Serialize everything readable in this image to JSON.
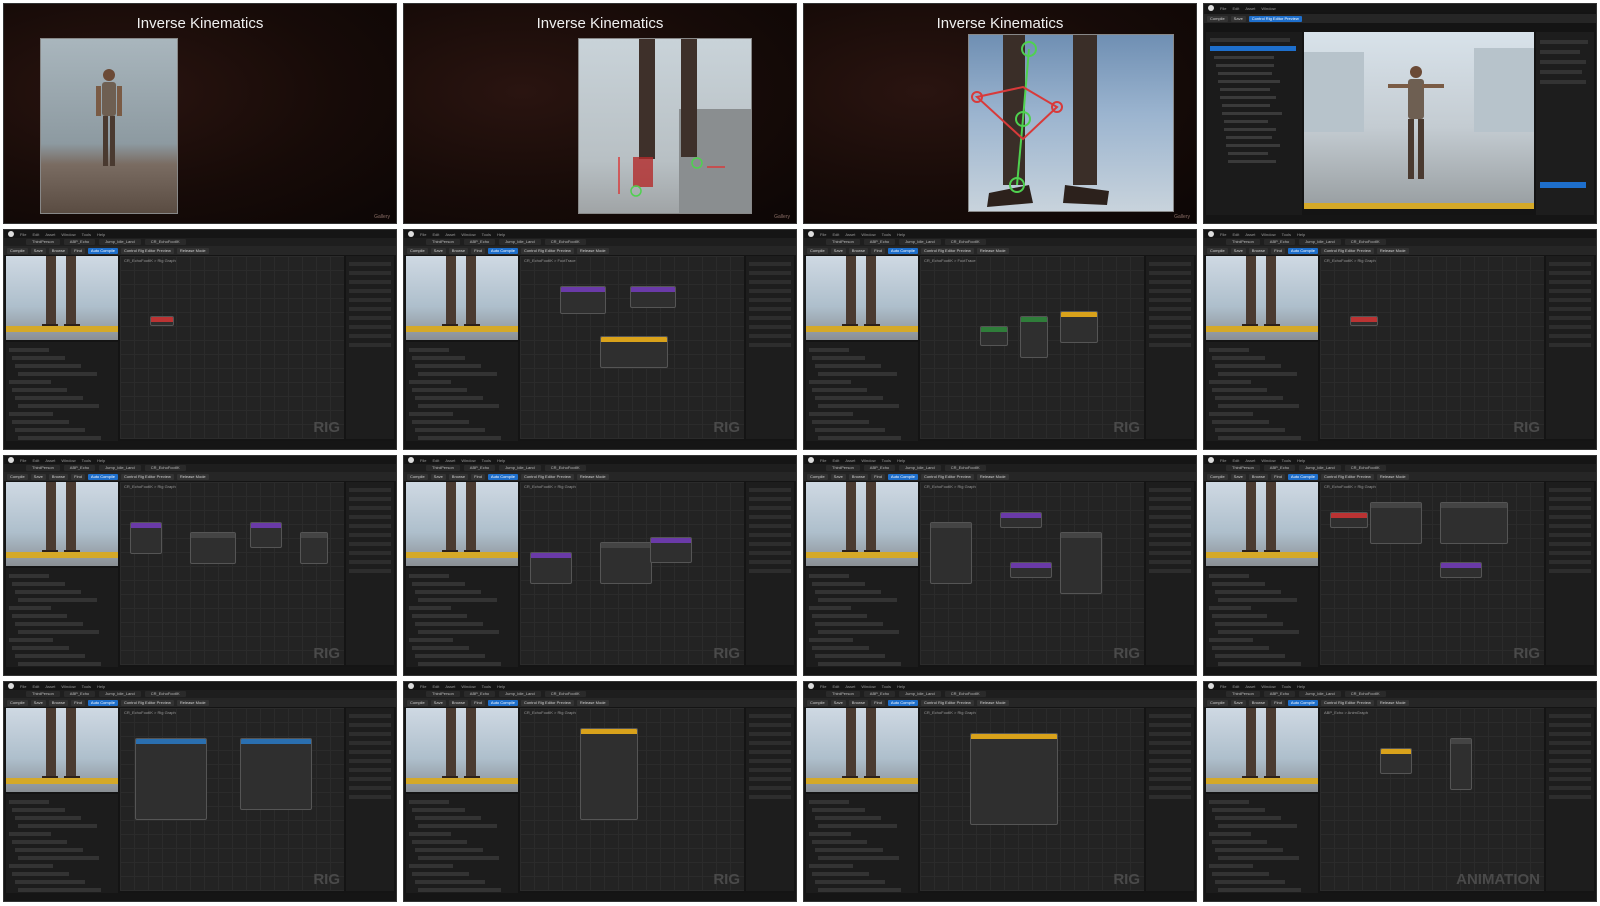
{
  "slides": [
    {
      "title": "Inverse Kinematics",
      "footer": "Gallery"
    },
    {
      "title": "Inverse Kinematics",
      "footer": "Gallery"
    },
    {
      "title": "Inverse Kinematics",
      "footer": "Gallery"
    }
  ],
  "editor": {
    "menu": [
      "File",
      "Edit",
      "Asset",
      "Window",
      "Tools",
      "Help"
    ],
    "tabs": [
      "ThirdPerson",
      "ABP_Echo",
      "Jump_Idle_Land",
      "CR_EchoFootIK"
    ],
    "toolbar": [
      "Compile",
      "Save",
      "Browse",
      "Find",
      "Auto Compile",
      "Control Rig Editor Preview",
      "Release Mode"
    ],
    "panels": [
      {
        "graph_title": "CR_EchoFootIK > Rig Graph",
        "watermark": "RIG"
      },
      {
        "graph_title": "CR_EchoFootIK > FootTrace",
        "watermark": "RIG"
      },
      {
        "graph_title": "CR_EchoFootIK > FootTrace",
        "watermark": "RIG"
      },
      {
        "graph_title": "CR_EchoFootIK > Rig Graph",
        "watermark": "RIG"
      },
      {
        "graph_title": "CR_EchoFootIK > Rig Graph",
        "watermark": "RIG"
      },
      {
        "graph_title": "CR_EchoFootIK > Rig Graph",
        "watermark": "RIG"
      },
      {
        "graph_title": "CR_EchoFootIK > Rig Graph",
        "watermark": "RIG"
      },
      {
        "graph_title": "CR_EchoFootIK > Rig Graph",
        "watermark": "RIG"
      },
      {
        "graph_title": "CR_EchoFootIK > Rig Graph",
        "watermark": "RIG"
      },
      {
        "graph_title": "CR_EchoFootIK > Rig Graph",
        "watermark": "RIG"
      },
      {
        "graph_title": "CR_EchoFootIK > Rig Graph",
        "watermark": "RIG"
      },
      {
        "graph_title": "ABP_Echo > AnimGraph",
        "watermark": "ANIMATION"
      }
    ]
  },
  "colors": {
    "accent": "#1e6fcc",
    "warning": "#d5a928",
    "ik_marker": "#d83a3a",
    "ik_joint": "#4fd14f"
  }
}
